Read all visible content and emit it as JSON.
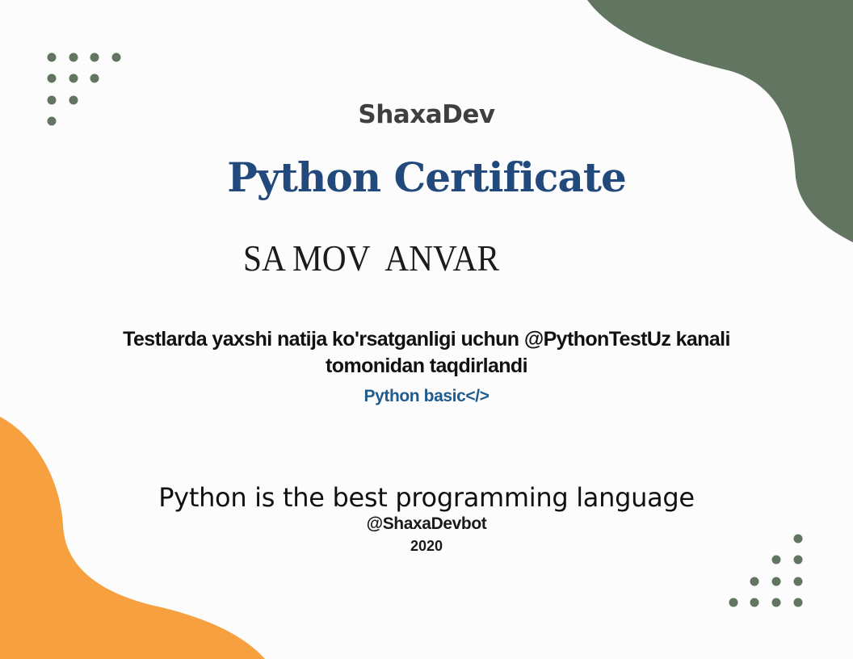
{
  "certificate": {
    "brand": "ShaxaDev",
    "title": "Python Certificate",
    "recipient_name": "SA MOV  ANVAR",
    "description": "Testlarda yaxshi natija ko'rsatganligi uchun @PythonTestUz kanali tomonidan taqdirlandi",
    "course": "Python basic</>",
    "slogan": "Python is the best programming language",
    "handle": "@ShaxaDevbot",
    "year": "2020"
  },
  "colors": {
    "background": "#fcfcfc",
    "green_accent": "#627561",
    "orange_accent": "#f6a040",
    "title_blue": "#21497b",
    "course_blue": "#1f5b8c"
  }
}
